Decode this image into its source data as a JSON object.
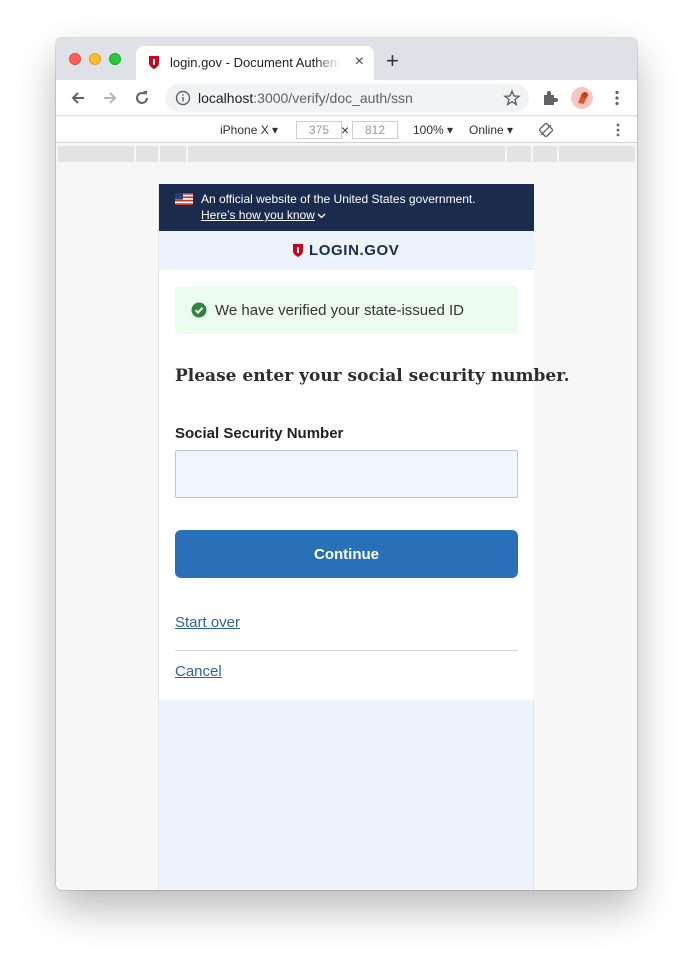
{
  "browser": {
    "tab_title": "login.gov - Document Authentication",
    "tab_close": "×",
    "new_tab": "+",
    "url_host": "localhost",
    "url_path": ":3000/verify/doc_auth/ssn"
  },
  "devtools": {
    "device": "iPhone X ▾",
    "width": "375",
    "height": "812",
    "times": "×",
    "zoom": "100% ▾",
    "network": "Online ▾"
  },
  "gov_banner": {
    "text": "An official website of the United States government.",
    "link": "Here’s how you know"
  },
  "logo": {
    "text": "LOGIN.GOV"
  },
  "alert": {
    "text": "We have verified your state-issued ID"
  },
  "form": {
    "heading": "Please enter your social security number.",
    "ssn_label": "Social Security Number",
    "ssn_value": "",
    "continue_label": "Continue"
  },
  "links": {
    "start_over": "Start over",
    "cancel": "Cancel"
  },
  "colors": {
    "banner": "#1b2b4e",
    "primary": "#2a70b8",
    "success": "#2e8540",
    "brand_red": "#d0021b"
  },
  "icons": [
    "shield-icon",
    "back-icon",
    "forward-icon",
    "reload-icon",
    "info-icon",
    "star-icon",
    "extensions-icon",
    "kebab-icon",
    "rotate-icon",
    "flag-icon",
    "chevron-down-icon",
    "check-circle-icon"
  ]
}
